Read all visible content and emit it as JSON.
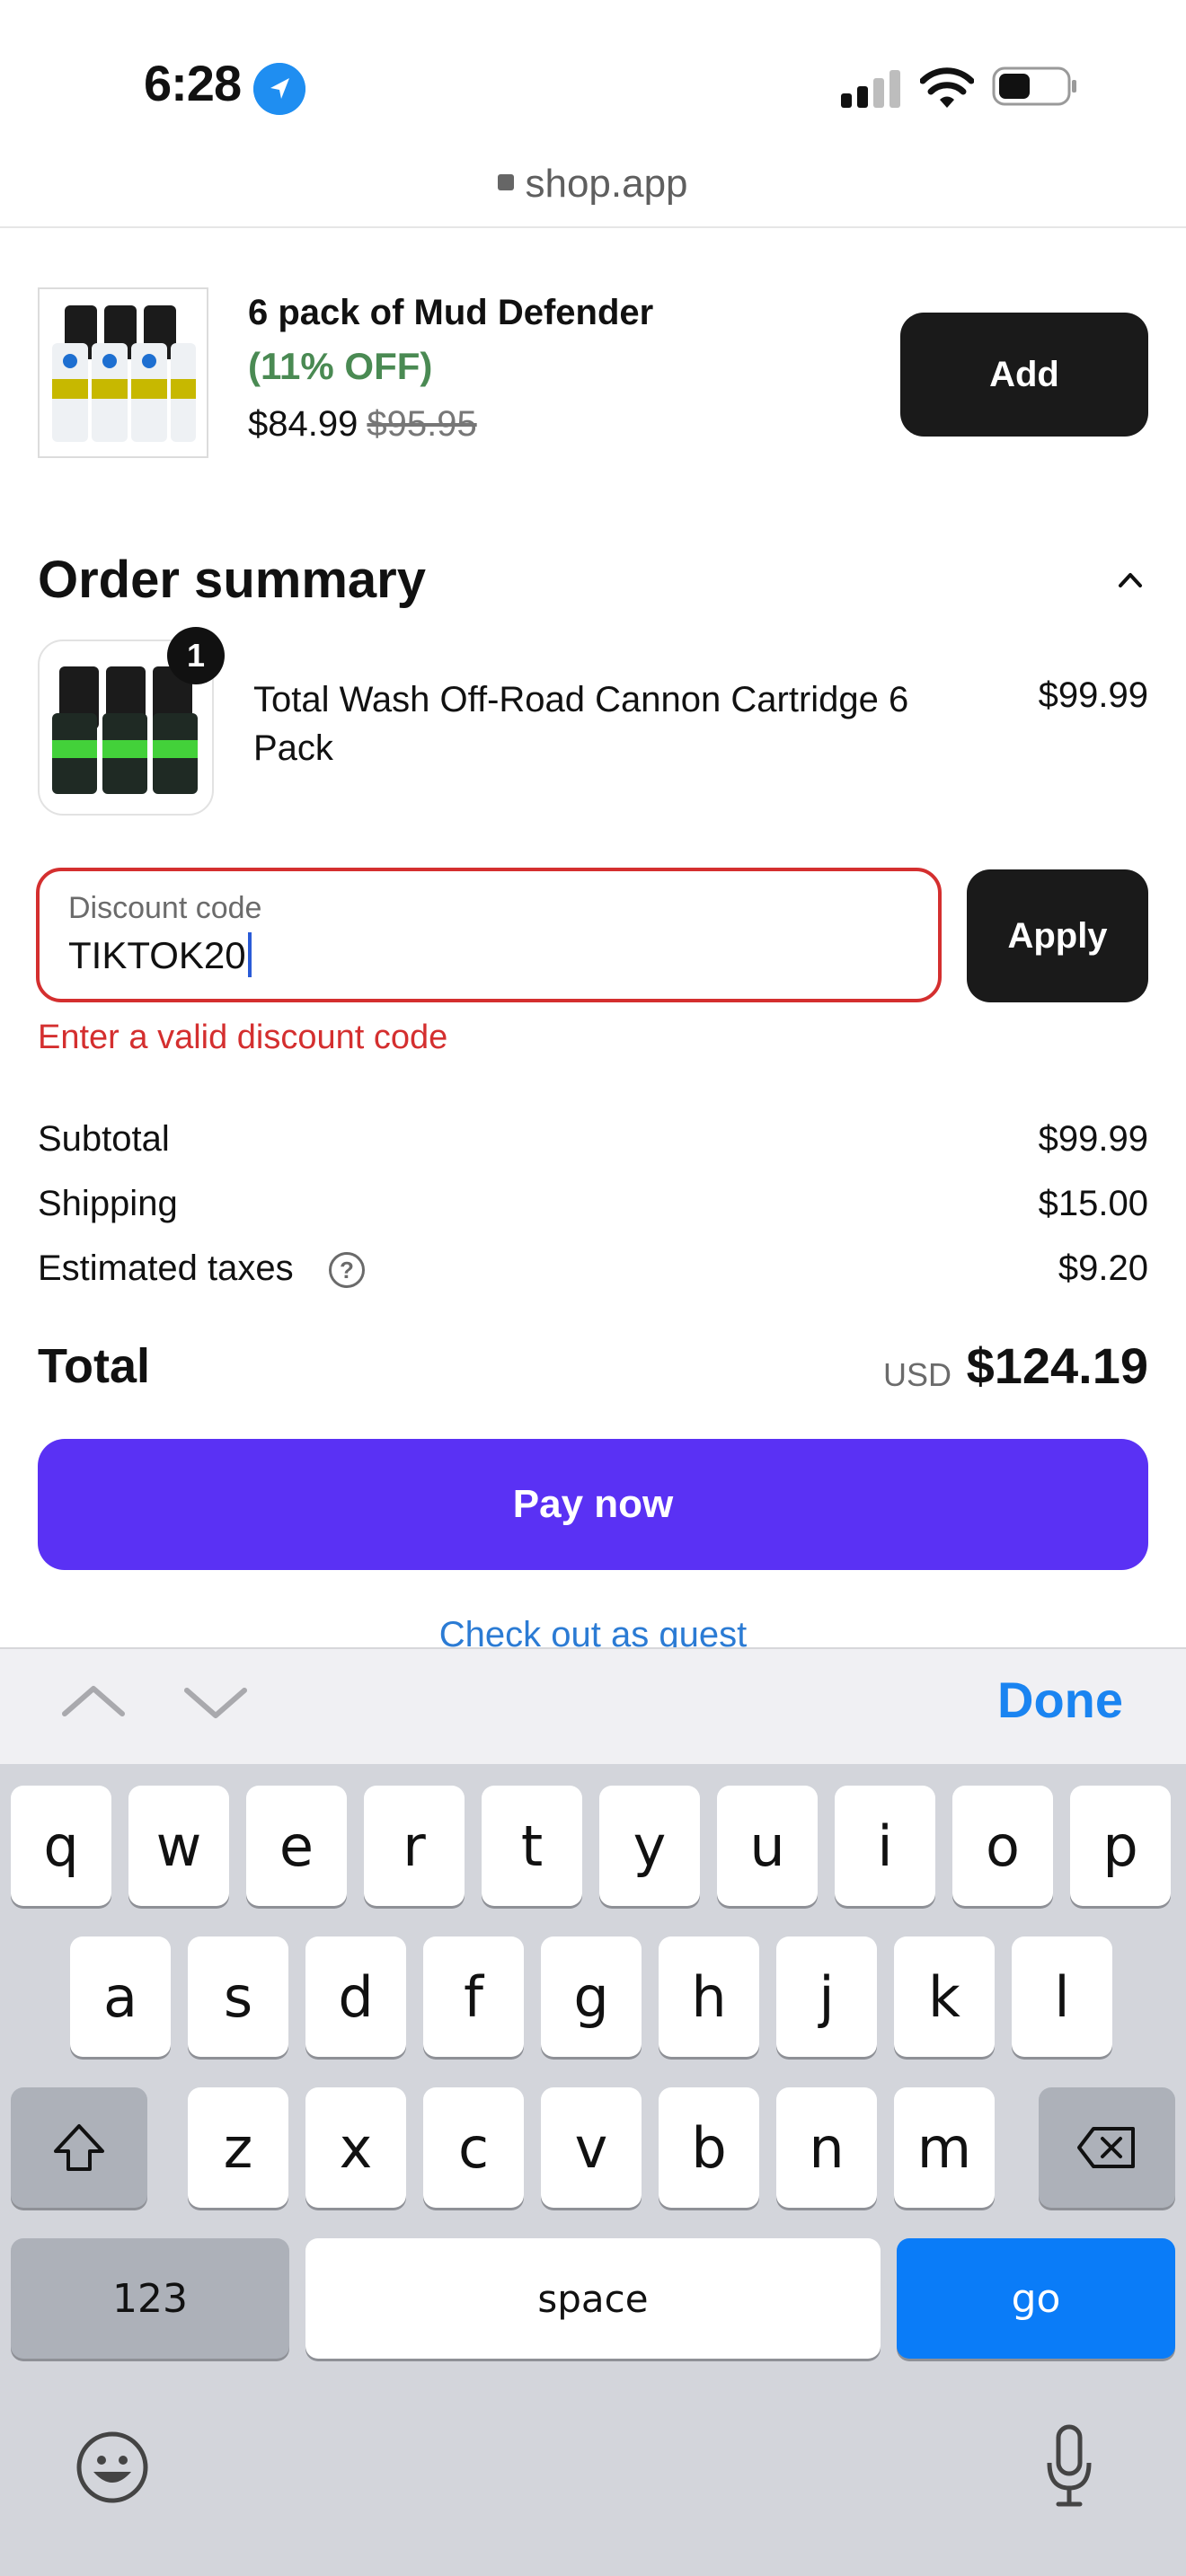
{
  "status_bar": {
    "time": "6:28"
  },
  "browser": {
    "url": "shop.app"
  },
  "upsell": {
    "name": "6 pack of Mud Defender",
    "discount": "(11% OFF)",
    "price": "$84.99",
    "original_price": "$95.95",
    "add_label": "Add"
  },
  "order_summary": {
    "title": "Order summary",
    "item": {
      "quantity": "1",
      "name": "Total Wash Off-Road Cannon Cartridge 6 Pack",
      "price": "$99.99"
    }
  },
  "discount": {
    "label": "Discount code",
    "value": "TIKTOK20",
    "apply_label": "Apply",
    "error": "Enter a valid discount code"
  },
  "totals": {
    "subtotal_label": "Subtotal",
    "subtotal": "$99.99",
    "shipping_label": "Shipping",
    "shipping": "$15.00",
    "taxes_label": "Estimated taxes",
    "taxes": "$9.20",
    "total_label": "Total",
    "currency": "USD",
    "total": "$124.19"
  },
  "actions": {
    "pay_label": "Pay now",
    "guest_label": "Check out as guest"
  },
  "keyboard": {
    "done_label": "Done",
    "row1": [
      "q",
      "w",
      "e",
      "r",
      "t",
      "y",
      "u",
      "i",
      "o",
      "p"
    ],
    "row2": [
      "a",
      "s",
      "d",
      "f",
      "g",
      "h",
      "j",
      "k",
      "l"
    ],
    "row3": [
      "z",
      "x",
      "c",
      "v",
      "b",
      "n",
      "m"
    ],
    "numbers_label": "123",
    "space_label": "space",
    "go_label": "go"
  },
  "colors": {
    "accent": "#5a31f4",
    "error": "#d42f2f",
    "discount_green": "#4a8a53",
    "keyboard_blue": "#0a7cf8"
  }
}
